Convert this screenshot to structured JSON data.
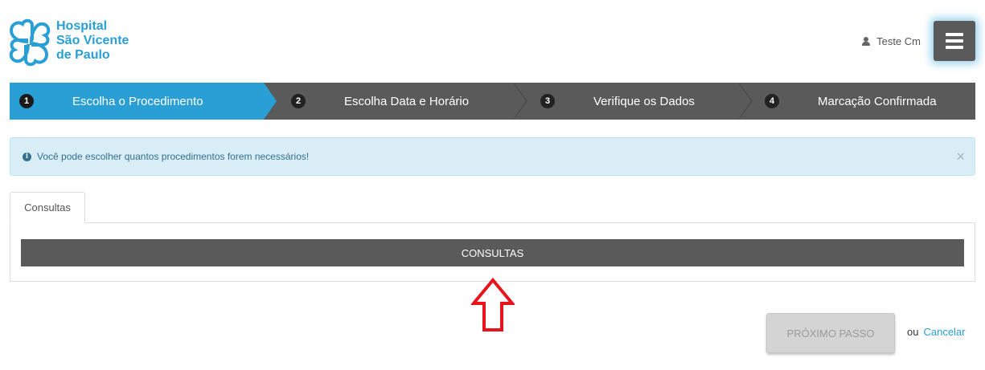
{
  "header": {
    "logo_lines": [
      "Hospital",
      "São Vicente",
      "de Paulo"
    ],
    "user_name": "Teste Cm",
    "icons": {
      "user": "user-icon",
      "menu": "hamburger-menu-icon"
    }
  },
  "steps": [
    {
      "number": "1",
      "label": "Escolha o Procedimento",
      "active": true
    },
    {
      "number": "2",
      "label": "Escolha Data e Horário",
      "active": false
    },
    {
      "number": "3",
      "label": "Verifique os Dados",
      "active": false
    },
    {
      "number": "4",
      "label": "Marcação Confirmada",
      "active": false
    }
  ],
  "alert": {
    "icon": "info-icon",
    "message": "Você pode escolher quantos procedimentos forem necessários!",
    "close": "×"
  },
  "tabs": [
    {
      "label": "Consultas"
    }
  ],
  "panel": {
    "category_label": "CONSULTAS"
  },
  "footer": {
    "next_label": "PRÓXIMO PASSO",
    "or_text": "ou",
    "cancel_label": "Cancelar"
  },
  "colors": {
    "accent": "#2a9fd6",
    "dark_bar": "#5a5a5a",
    "alert_bg": "#d9edf7",
    "annotation_arrow": "#e8141c"
  }
}
